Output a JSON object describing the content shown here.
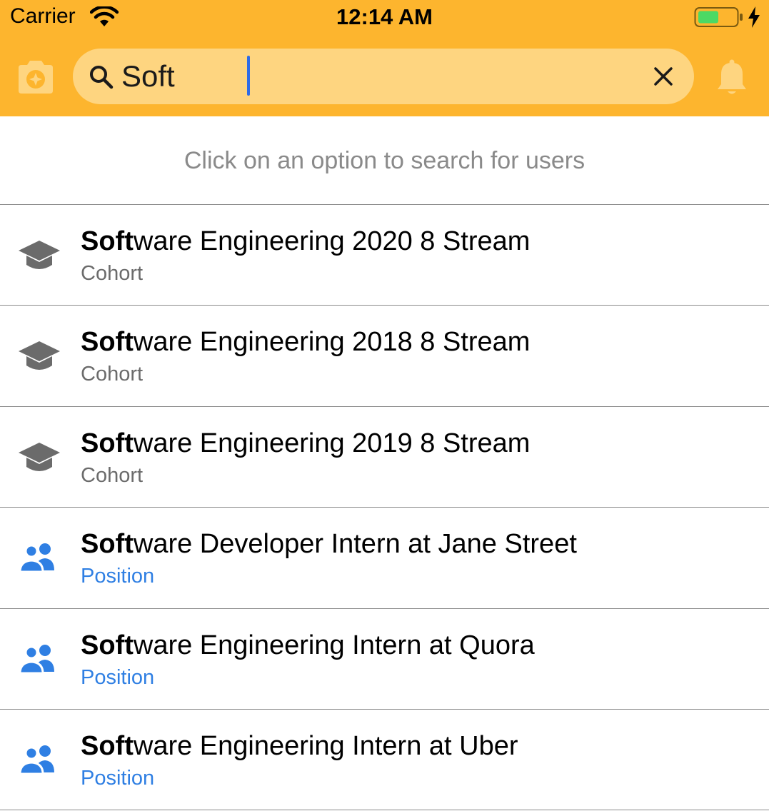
{
  "status_bar": {
    "carrier": "Carrier",
    "time": "12:14 AM"
  },
  "search": {
    "query": "Soft",
    "placeholder": ""
  },
  "hint": "Click on an option to search for users",
  "colors": {
    "header_bg": "#FDB52E",
    "search_bg": "#FED580",
    "cohort_type": "#6b6b6b",
    "position_type": "#2F7FE3",
    "cohort_icon": "#6b6b6b",
    "position_icon": "#2F7FE3"
  },
  "results": [
    {
      "match": "Soft",
      "rest": "ware Engineering 2020 8 Stream",
      "type": "Cohort",
      "icon": "graduation-cap-icon"
    },
    {
      "match": "Soft",
      "rest": "ware Engineering 2018 8 Stream",
      "type": "Cohort",
      "icon": "graduation-cap-icon"
    },
    {
      "match": "Soft",
      "rest": "ware Engineering 2019 8 Stream",
      "type": "Cohort",
      "icon": "graduation-cap-icon"
    },
    {
      "match": "Soft",
      "rest": "ware Developer Intern at Jane Street",
      "type": "Position",
      "icon": "people-icon"
    },
    {
      "match": "Soft",
      "rest": "ware Engineering Intern at Quora",
      "type": "Position",
      "icon": "people-icon"
    },
    {
      "match": "Soft",
      "rest": "ware Engineering Intern at Uber",
      "type": "Position",
      "icon": "people-icon"
    }
  ]
}
